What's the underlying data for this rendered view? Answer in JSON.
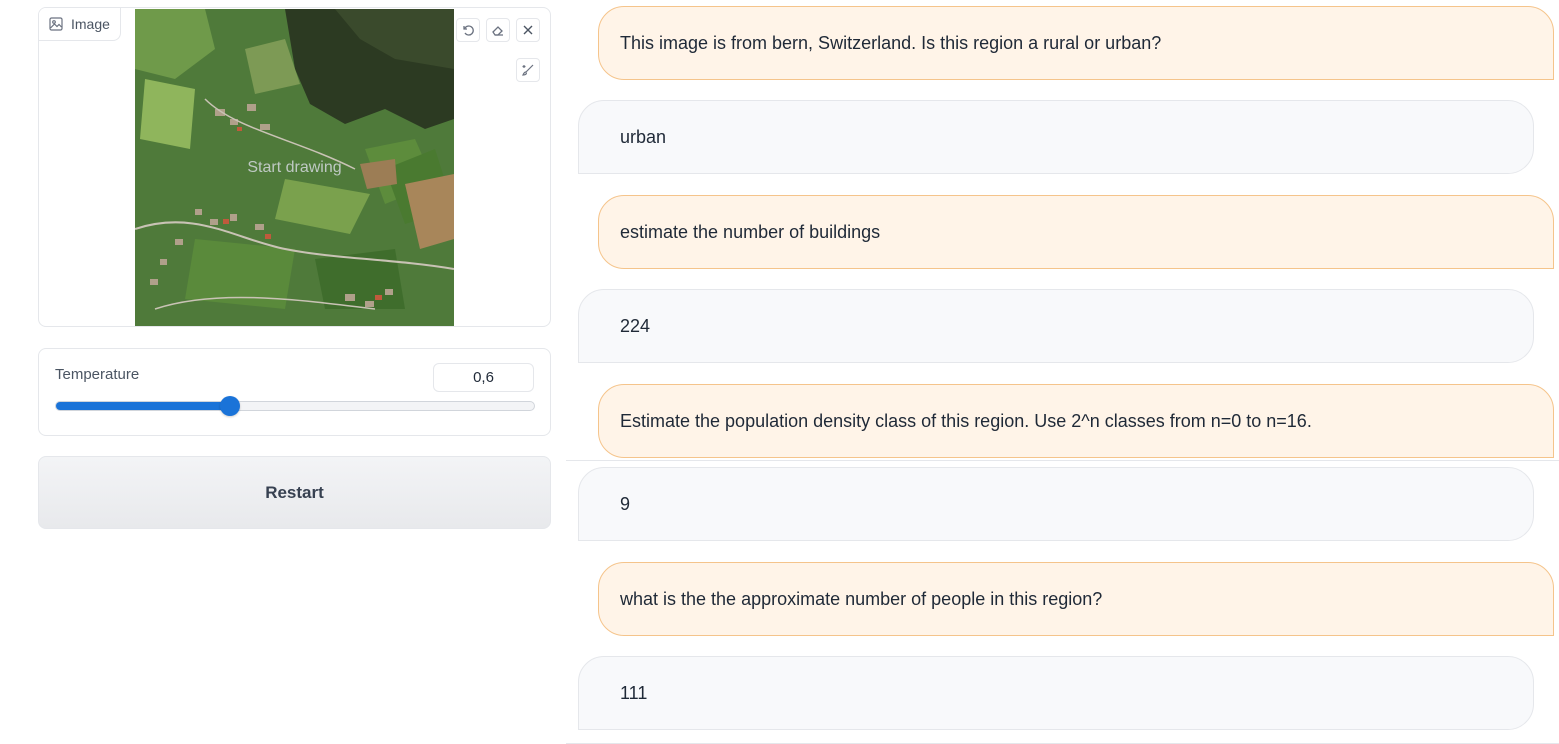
{
  "image_panel": {
    "label": "Image",
    "icon": "image-icon",
    "placeholder": "Start drawing",
    "tools": [
      "undo-icon",
      "eraser-icon",
      "close-icon",
      "brush-icon"
    ]
  },
  "temperature": {
    "label": "Temperature",
    "value": "0,6",
    "fraction": 0.365
  },
  "restart_label": "Restart",
  "chat": {
    "messages": [
      {
        "role": "user",
        "text": "This image is from bern, Switzerland. Is this region a rural or urban?"
      },
      {
        "role": "bot",
        "text": "urban"
      },
      {
        "role": "user",
        "text": "estimate the number of buildings"
      },
      {
        "role": "bot",
        "text": "224"
      },
      {
        "role": "user",
        "text": "Estimate the population density class of this region. Use 2^n classes from n=0 to n=16."
      },
      {
        "role": "bot",
        "text": "9"
      },
      {
        "role": "user",
        "text": "what is the the approximate number of people in this region?"
      },
      {
        "role": "bot",
        "text": "111"
      }
    ]
  }
}
